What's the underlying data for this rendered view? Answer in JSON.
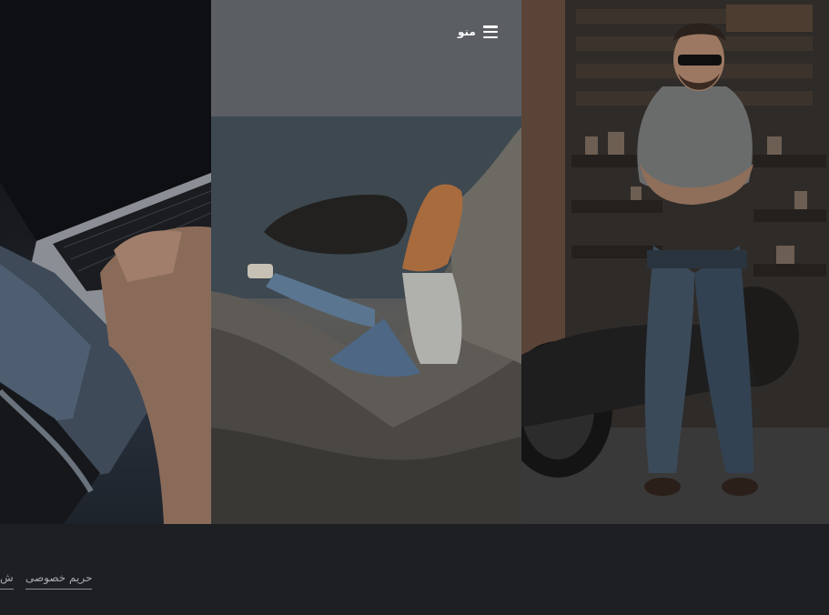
{
  "header": {
    "menu_label": "منو"
  },
  "gallery": {
    "images": [
      {
        "subject": "laptop-typing"
      },
      {
        "subject": "woman-on-cliff-by-sea"
      },
      {
        "subject": "man-with-motorcycle-in-garage"
      }
    ]
  },
  "footer": {
    "links": [
      {
        "label": "حریم خصوصی"
      },
      {
        "label": "ش"
      }
    ]
  }
}
